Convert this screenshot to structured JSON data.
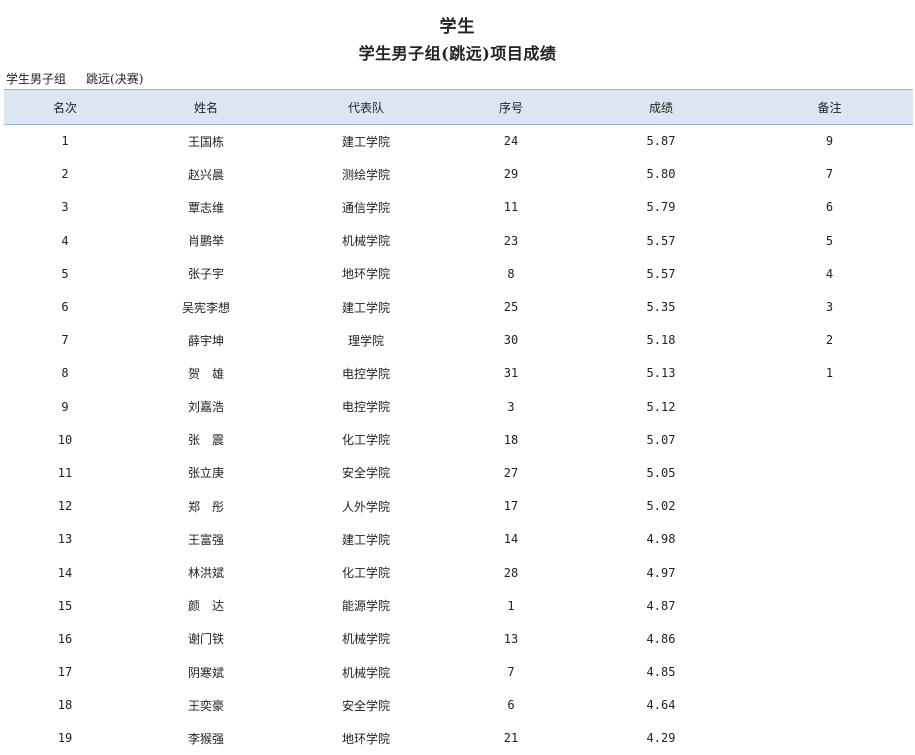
{
  "header": {
    "title": "学生",
    "subtitle": "学生男子组(跳远)项目成绩",
    "group": "学生男子组",
    "event": "跳远(决赛)"
  },
  "table": {
    "columns": [
      "名次",
      "姓名",
      "代表队",
      "序号",
      "成绩",
      "备注"
    ],
    "rows": [
      {
        "rank": "1",
        "name": "王国栋",
        "team": "建工学院",
        "seq": "24",
        "score": "5.87",
        "note": "9"
      },
      {
        "rank": "2",
        "name": "赵兴晨",
        "team": "测绘学院",
        "seq": "29",
        "score": "5.80",
        "note": "7"
      },
      {
        "rank": "3",
        "name": "覃志维",
        "team": "通信学院",
        "seq": "11",
        "score": "5.79",
        "note": "6"
      },
      {
        "rank": "4",
        "name": "肖鹏举",
        "team": "机械学院",
        "seq": "23",
        "score": "5.57",
        "note": "5"
      },
      {
        "rank": "5",
        "name": "张子宇",
        "team": "地环学院",
        "seq": "8",
        "score": "5.57",
        "note": "4"
      },
      {
        "rank": "6",
        "name": "吴宪李想",
        "team": "建工学院",
        "seq": "25",
        "score": "5.35",
        "note": "3"
      },
      {
        "rank": "7",
        "name": "薛宇坤",
        "team": "理学院",
        "seq": "30",
        "score": "5.18",
        "note": "2"
      },
      {
        "rank": "8",
        "name": "贺　雄",
        "team": "电控学院",
        "seq": "31",
        "score": "5.13",
        "note": "1"
      },
      {
        "rank": "9",
        "name": "刘嘉浩",
        "team": "电控学院",
        "seq": "3",
        "score": "5.12",
        "note": ""
      },
      {
        "rank": "10",
        "name": "张　震",
        "team": "化工学院",
        "seq": "18",
        "score": "5.07",
        "note": ""
      },
      {
        "rank": "11",
        "name": "张立庚",
        "team": "安全学院",
        "seq": "27",
        "score": "5.05",
        "note": ""
      },
      {
        "rank": "12",
        "name": "郑　彤",
        "team": "人外学院",
        "seq": "17",
        "score": "5.02",
        "note": ""
      },
      {
        "rank": "13",
        "name": "王富强",
        "team": "建工学院",
        "seq": "14",
        "score": "4.98",
        "note": ""
      },
      {
        "rank": "14",
        "name": "林洪斌",
        "team": "化工学院",
        "seq": "28",
        "score": "4.97",
        "note": ""
      },
      {
        "rank": "15",
        "name": "颜　达",
        "team": "能源学院",
        "seq": "1",
        "score": "4.87",
        "note": ""
      },
      {
        "rank": "16",
        "name": "谢门铁",
        "team": "机械学院",
        "seq": "13",
        "score": "4.86",
        "note": ""
      },
      {
        "rank": "17",
        "name": "阴寒斌",
        "team": "机械学院",
        "seq": "7",
        "score": "4.85",
        "note": ""
      },
      {
        "rank": "18",
        "name": "王奕豪",
        "team": "安全学院",
        "seq": "6",
        "score": "4.64",
        "note": ""
      },
      {
        "rank": "19",
        "name": "李猴强",
        "team": "地环学院",
        "seq": "21",
        "score": "4.29",
        "note": ""
      }
    ]
  }
}
